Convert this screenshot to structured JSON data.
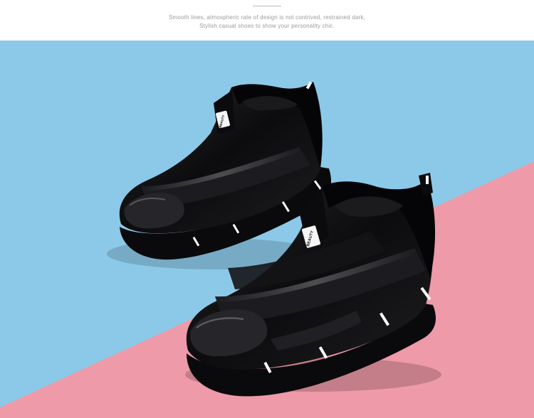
{
  "header": {
    "tagline_line1": "Smooth lines, atmospheric rate of design is not contrived, restrained dark,",
    "tagline_line2": "Stylish casual shoes to show your personality chic."
  },
  "photo": {
    "colors": {
      "blue_background": "#8cc9e8",
      "pink_background": "#ee9aa8",
      "shoe_black": "#101012",
      "accent_white": "#ffffff"
    },
    "shoes": [
      {
        "badge_text": "BEAUTY"
      },
      {
        "badge_text": "BEAUTY"
      }
    ]
  }
}
